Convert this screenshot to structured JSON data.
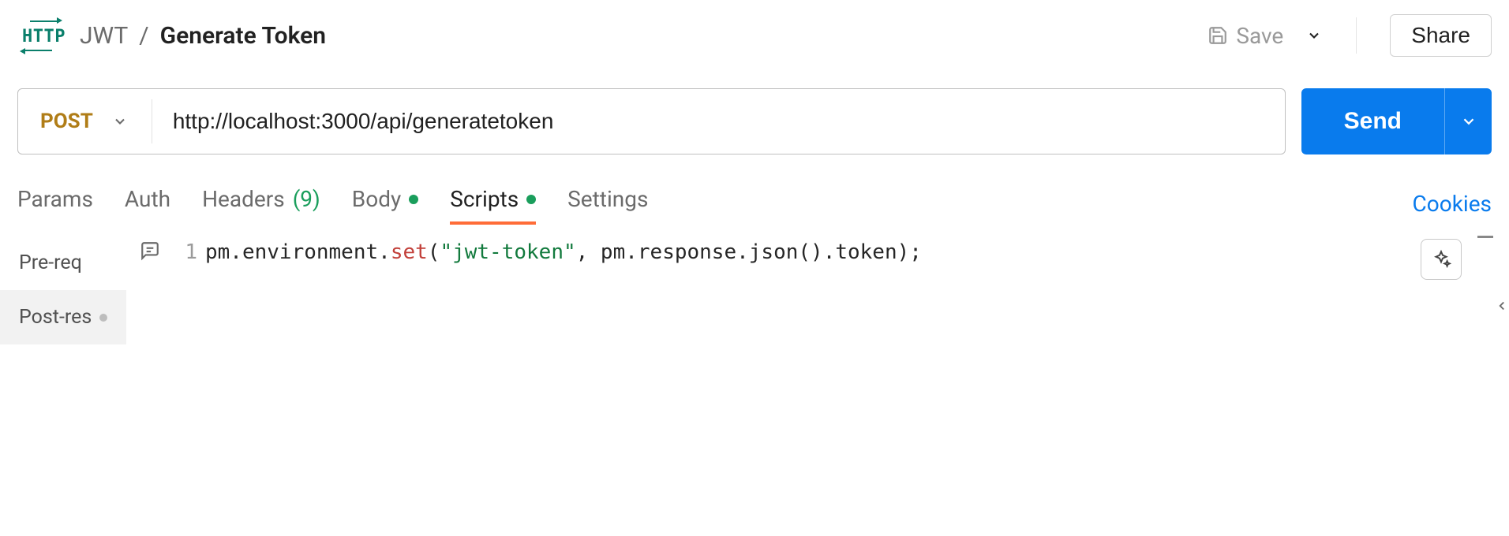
{
  "breadcrumb": {
    "collection": "JWT",
    "request": "Generate Token"
  },
  "toolbar": {
    "save_label": "Save",
    "share_label": "Share"
  },
  "request": {
    "method": "POST",
    "url": "http://localhost:3000/api/generatetoken",
    "send_label": "Send"
  },
  "tabs": {
    "params": "Params",
    "auth": "Auth",
    "headers_label": "Headers",
    "headers_count": "(9)",
    "body": "Body",
    "scripts": "Scripts",
    "settings": "Settings",
    "cookies": "Cookies"
  },
  "script_sidebar": {
    "pre": "Pre-req",
    "post": "Post-res"
  },
  "editor": {
    "line_no": "1",
    "code_tokens": {
      "p1": "pm.environment.",
      "fn": "set",
      "p2": "(",
      "str": "\"jwt-token\"",
      "p3": ", pm.response.json().token);"
    }
  }
}
